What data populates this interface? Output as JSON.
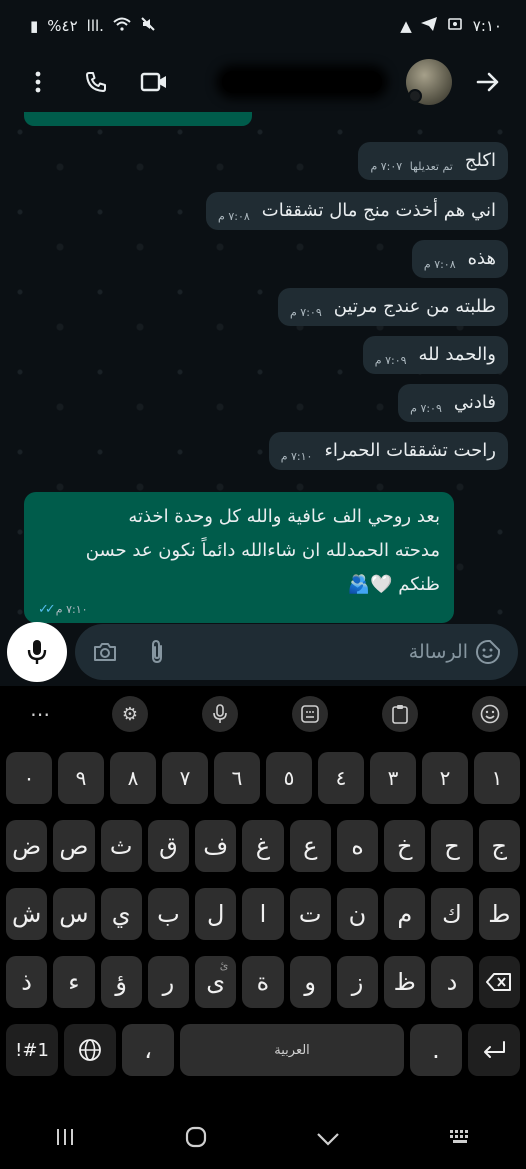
{
  "status_bar": {
    "time": "٧:١٠",
    "battery": "%٤٢",
    "signal": "ااا."
  },
  "contact": {
    "name_redacted": ""
  },
  "messages": [
    {
      "direction": "in",
      "text": "اكلج",
      "edited_label": "تم تعديلها",
      "time": "٧:٠٧ م"
    },
    {
      "direction": "in",
      "text": "اني هم أخذت منج مال تشققات",
      "time": "٧:٠٨ م"
    },
    {
      "direction": "in",
      "text": "هذه",
      "time": "٧:٠٨ م"
    },
    {
      "direction": "in",
      "text": "طلبته من عندج مرتين",
      "time": "٧:٠٩ م"
    },
    {
      "direction": "in",
      "text": "والحمد لله",
      "time": "٧:٠٩ م"
    },
    {
      "direction": "in",
      "text": "فادني",
      "time": "٧:٠٩ م"
    },
    {
      "direction": "in",
      "text": "راحت تشققات الحمراء",
      "time": "٧:١٠ م"
    },
    {
      "direction": "out",
      "lines": [
        "بعد روحي الف عافية والله كل وحدة اخذته",
        "مدحته الحمدلله ان شاءالله دائماً نكون عد حسن",
        "ظنكم 🤍🫂"
      ],
      "time": "٧:١٠ م",
      "status": "read"
    }
  ],
  "composer": {
    "placeholder": "الرسالة",
    "icons": [
      "mic-icon",
      "camera-icon",
      "attach-icon",
      "sticker-icon"
    ]
  },
  "keyboard": {
    "toolbar": [
      "more-icon",
      "settings-icon",
      "voice-icon",
      "layout-icon",
      "clipboard-icon",
      "emoji-icon"
    ],
    "row_numbers": [
      "١",
      "٢",
      "٣",
      "٤",
      "٥",
      "٦",
      "٧",
      "٨",
      "٩",
      "٠"
    ],
    "row1": [
      "ض",
      "ص",
      "ث",
      "ق",
      "ف",
      "غ",
      "ع",
      "ه",
      "خ",
      "ح",
      "ج"
    ],
    "row2": [
      "ش",
      "س",
      "ي",
      "ب",
      "ل",
      "ا",
      "ت",
      "ن",
      "م",
      "ك",
      "ط"
    ],
    "row3": [
      "ذ",
      "ء",
      "ؤ",
      "ر",
      "ى",
      "ة",
      "و",
      "ز",
      "ظ",
      "د"
    ],
    "row3_subs": {
      "ى": "ئ"
    },
    "bottom": {
      "symbols": "!#1",
      "comma": "،",
      "space": "العربية",
      "period": "."
    }
  },
  "colors": {
    "incoming_bubble": "#202c33",
    "outgoing_bubble": "#005c4b",
    "read_ticks": "#53bdeb",
    "background": "#0b1014"
  }
}
